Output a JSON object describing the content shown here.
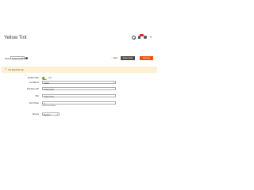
{
  "header": {
    "page_title": "Yellow Tint",
    "icons": [
      "search-icon",
      "bell-icon",
      "user-icon"
    ]
  },
  "scope": {
    "label": "Scope:",
    "selected": "Default Store View"
  },
  "actions": {
    "back_label": "Back",
    "back_arrow": "←",
    "reset_label": "",
    "delete_label": "Delete Rule",
    "save_label": "Save",
    "save_split": "▾"
  },
  "message": {
    "icon": "check-icon",
    "text": "You saved the rule."
  },
  "form": {
    "enable": {
      "label": "Enable Rule",
      "value": "Yes"
    },
    "field_2": {
      "label": "Conditions",
      "value": "Yellow"
    },
    "field_3": {
      "label": "Replace with",
      "value": "Yellow Gold"
    },
    "field_4": {
      "label": "Title",
      "value": "Yellow Gold",
      "link": ""
    },
    "field_5": {
      "label": "Sort Order",
      "value": "0",
      "note": "Use Default Value",
      "link": ""
    },
    "field_6": {
      "label": "Priority",
      "value": "Medium"
    }
  },
  "colors": {
    "accent": "#eb5202",
    "dark_button": "#514943",
    "message_bg": "#fdf0d5",
    "success": "#79a22e",
    "link": "#007bdb"
  }
}
